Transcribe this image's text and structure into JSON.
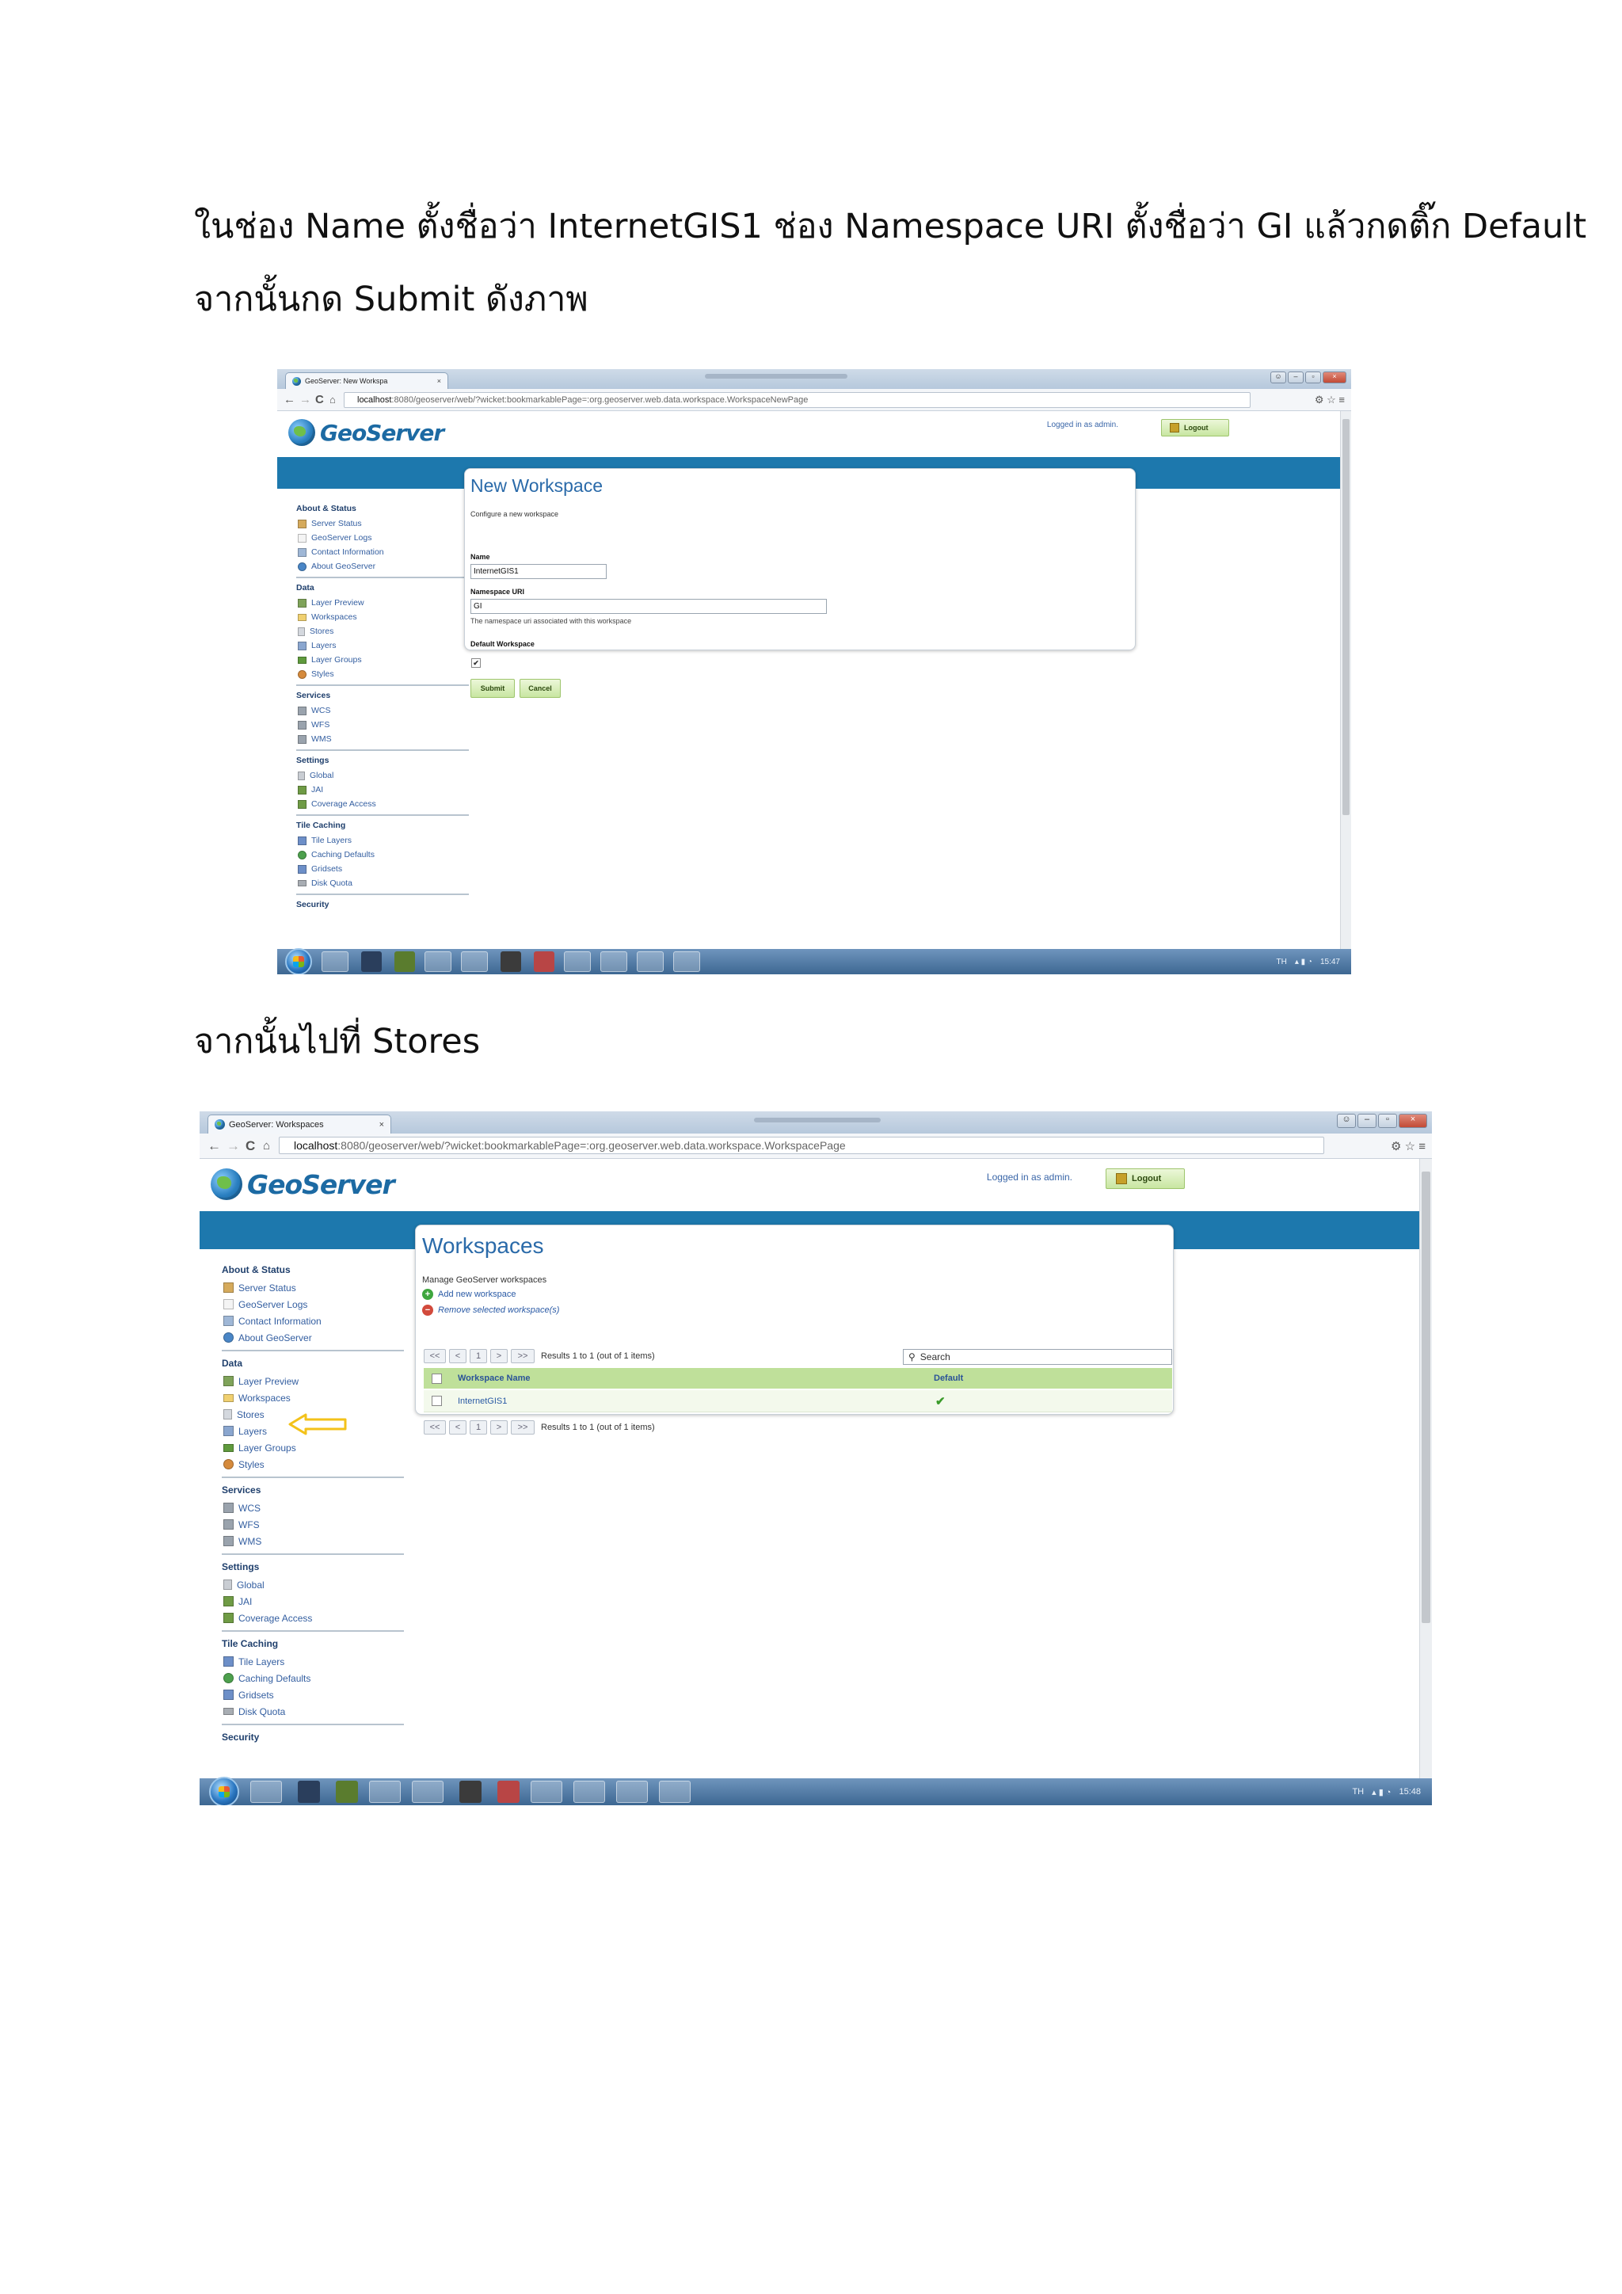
{
  "paragraphs": {
    "p1_line1": "ในช่อง Name ตั้งชื่อว่า InternetGIS1 ช่อง Namespace URI ตั้งชื่อว่า GI  แล้วกดติ๊ก Default",
    "p1_line2": "จากนั้นกด Submit ดังภาพ",
    "p2": "จากนั้นไปที่ Stores"
  },
  "shot1": {
    "tab_title": "GeoServer: New Workspa",
    "url_host": "localhost",
    "url_path": ":8080/geoserver/web/?wicket:bookmarkablePage=:org.geoserver.web.data.workspace.WorkspaceNewPage",
    "logo": "GeoServer",
    "logged_in": "Logged in as admin.",
    "logout": "Logout",
    "page_title": "New Workspace",
    "page_subtitle": "Configure a new workspace",
    "name_label": "Name",
    "name_value": "InternetGIS1",
    "uri_label": "Namespace URI",
    "uri_value": "GI",
    "uri_hint": "The namespace uri associated with this workspace",
    "default_label": "Default Workspace",
    "check": "✔",
    "submit": "Submit",
    "cancel": "Cancel",
    "tray_lang": "TH",
    "tray_time": "15:47"
  },
  "shot2": {
    "tab_title": "GeoServer: Workspaces",
    "url_host": "localhost",
    "url_path": ":8080/geoserver/web/?wicket:bookmarkablePage=:org.geoserver.web.data.workspace.WorkspacePage",
    "logo": "GeoServer",
    "logged_in": "Logged in as admin.",
    "logout": "Logout",
    "page_title": "Workspaces",
    "page_subtitle": "Manage GeoServer workspaces",
    "add_new": "Add new workspace",
    "remove": "Remove selected workspace(s)",
    "pager_first": "<<",
    "pager_prev": "<",
    "pager_page": "1",
    "pager_next": ">",
    "pager_last": ">>",
    "results": "Results 1 to 1 (out of 1 items)",
    "search": "Search",
    "col_name": "Workspace Name",
    "col_default": "Default",
    "row_name": "InternetGIS1",
    "row_default": "✔",
    "tray_lang": "TH",
    "tray_time": "15:48"
  },
  "sidebar": {
    "about": "About & Status",
    "server_status": "Server Status",
    "geoserver_logs": "GeoServer Logs",
    "contact_info": "Contact Information",
    "about_geoserver": "About GeoServer",
    "data": "Data",
    "layer_preview": "Layer Preview",
    "workspaces": "Workspaces",
    "stores": "Stores",
    "layers": "Layers",
    "layer_groups": "Layer Groups",
    "styles": "Styles",
    "services": "Services",
    "wcs": "WCS",
    "wfs": "WFS",
    "wms": "WMS",
    "settings": "Settings",
    "global": "Global",
    "jai": "JAI",
    "coverage_access": "Coverage Access",
    "tile_caching": "Tile Caching",
    "tile_layers": "Tile Layers",
    "caching_defaults": "Caching Defaults",
    "gridsets": "Gridsets",
    "disk_quota": "Disk Quota",
    "security": "Security"
  },
  "colors": {
    "geoserver_blue": "#1d78ad",
    "green_button": "#c8e6a1",
    "annotation_arrow": "#f3c21a"
  }
}
